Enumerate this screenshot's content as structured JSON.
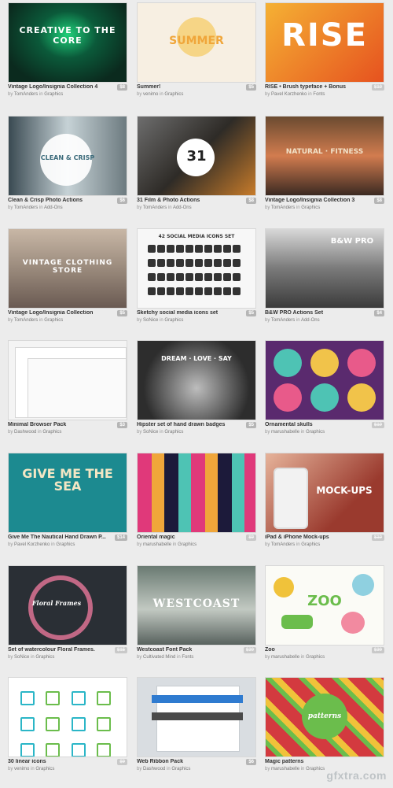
{
  "products": [
    {
      "title": "Vintage Logo/Insignia Collection 4",
      "by": "by",
      "author": "TomAnders",
      "in": "in",
      "category": "Graphics",
      "price": "$8",
      "sale": false,
      "thumb_text": "CREATIVE TO THE CORE",
      "thumb_colors": [
        "#0b2a1e",
        "#1fd07a"
      ]
    },
    {
      "title": "Summer!",
      "by": "by",
      "author": "venimo",
      "in": "in",
      "category": "Graphics",
      "price": "$5",
      "sale": false,
      "thumb_text": "SUMMER",
      "thumb_colors": [
        "#f7efe2",
        "#f0a63a"
      ]
    },
    {
      "title": "RISE • Brush typeface + Bonus",
      "by": "by",
      "author": "Pavel Korzhenko",
      "in": "in",
      "category": "Fonts",
      "price": "$10",
      "sale": true,
      "thumb_text": "RISE",
      "thumb_colors": [
        "#e6521f",
        "#f5b134"
      ]
    },
    {
      "title": "Clean & Crisp Photo Actions",
      "by": "by",
      "author": "TomAnders",
      "in": "in",
      "category": "Add-Ons",
      "price": "$6",
      "sale": false,
      "thumb_text": "CLEAN & CRISP",
      "thumb_colors": [
        "#3a4a52",
        "#c6d2d6"
      ]
    },
    {
      "title": "31 Film & Photo Actions",
      "by": "by",
      "author": "TomAnders",
      "in": "in",
      "category": "Add-Ons",
      "price": "$8",
      "sale": false,
      "thumb_text": "31",
      "thumb_colors": [
        "#2e2b27",
        "#c77b2a"
      ]
    },
    {
      "title": "Vintage Logo/Insignia Collection 3",
      "by": "by",
      "author": "TomAnders",
      "in": "in",
      "category": "Graphics",
      "price": "$8",
      "sale": false,
      "thumb_text": "NATURAL · FITNESS",
      "thumb_colors": [
        "#3b2a22",
        "#d27c4f"
      ]
    },
    {
      "title": "Vintage Logo/Insignia Collection",
      "by": "by",
      "author": "TomAnders",
      "in": "in",
      "category": "Graphics",
      "price": "$5",
      "sale": false,
      "thumb_text": "VINTAGE CLOTHING STORE",
      "thumb_colors": [
        "#6a5a52",
        "#c8b7a6"
      ]
    },
    {
      "title": "Sketchy social media icons set",
      "by": "by",
      "author": "SoNice",
      "in": "in",
      "category": "Graphics",
      "price": "$5",
      "sale": false,
      "thumb_text": "42 SOCIAL MEDIA ICONS SET",
      "thumb_colors": [
        "#f7f7f7",
        "#333333"
      ]
    },
    {
      "title": "B&W PRO Actions Set",
      "by": "by",
      "author": "TomAnders",
      "in": "in",
      "category": "Add-Ons",
      "price": "$4",
      "sale": false,
      "thumb_text": "B&W PRO",
      "thumb_colors": [
        "#3b3b3b",
        "#d8d8d8"
      ]
    },
    {
      "title": "Minimal Browser Pack",
      "by": "by",
      "author": "Dashwood",
      "in": "in",
      "category": "Graphics",
      "price": "$3",
      "sale": false,
      "thumb_text": "",
      "thumb_colors": [
        "#f4f4f4",
        "#d6d6d6"
      ]
    },
    {
      "title": "Hipster set of hand drawn badges",
      "by": "by",
      "author": "SoNice",
      "in": "in",
      "category": "Graphics",
      "price": "$5",
      "sale": false,
      "thumb_text": "DREAM · LOVE · SAY",
      "thumb_colors": [
        "#2d2d2d",
        "#bdbdbd"
      ]
    },
    {
      "title": "Ornamental skulls",
      "by": "by",
      "author": "marushabelle",
      "in": "in",
      "category": "Graphics",
      "price": "$10",
      "sale": true,
      "thumb_text": "",
      "thumb_colors": [
        "#5a2a6e",
        "#4ec3b4"
      ]
    },
    {
      "title": "Give Me The Nautical Hand Drawn P...",
      "by": "by",
      "author": "Pavel Korzhenko",
      "in": "in",
      "category": "Graphics",
      "price": "$14",
      "sale": false,
      "thumb_text": "GIVE ME THE SEA",
      "thumb_colors": [
        "#1c8a90",
        "#f3e6c4"
      ]
    },
    {
      "title": "Oriental magic",
      "by": "by",
      "author": "marushabelle",
      "in": "in",
      "category": "Graphics",
      "price": "$9",
      "sale": true,
      "thumb_text": "",
      "thumb_colors": [
        "#1c1a3a",
        "#e0397a"
      ]
    },
    {
      "title": "iPad & iPhone Mock-ups",
      "by": "by",
      "author": "TomAnders",
      "in": "in",
      "category": "Graphics",
      "price": "$10",
      "sale": true,
      "thumb_text": "MOCK-UPS",
      "thumb_colors": [
        "#9a3a2e",
        "#e6b39a"
      ]
    },
    {
      "title": "Set of watercolour Floral Frames.",
      "by": "by",
      "author": "SoNice",
      "in": "in",
      "category": "Graphics",
      "price": "$15",
      "sale": true,
      "thumb_text": "Floral Frames",
      "thumb_colors": [
        "#2a2f35",
        "#e7779a"
      ]
    },
    {
      "title": "Westcoast Font Pack",
      "by": "by",
      "author": "Cultivated Mind",
      "in": "in",
      "category": "Fonts",
      "price": "$30",
      "sale": true,
      "thumb_text": "WESTCOAST",
      "thumb_colors": [
        "#58625e",
        "#c2c9c2"
      ]
    },
    {
      "title": "Zoo",
      "by": "by",
      "author": "marushabelle",
      "in": "in",
      "category": "Graphics",
      "price": "$30",
      "sale": true,
      "thumb_text": "ZOO",
      "thumb_colors": [
        "#fbfbf6",
        "#f0c23a"
      ]
    },
    {
      "title": "30 linear icons",
      "by": "by",
      "author": "venimo",
      "in": "in",
      "category": "Graphics",
      "price": "$9",
      "sale": true,
      "thumb_text": "",
      "thumb_colors": [
        "#ffffff",
        "#2bb6c7"
      ]
    },
    {
      "title": "Web Ribbon Pack",
      "by": "by",
      "author": "Dashwood",
      "in": "in",
      "category": "Graphics",
      "price": "$6",
      "sale": false,
      "thumb_text": "",
      "thumb_colors": [
        "#d9dde1",
        "#2f7bd0"
      ]
    },
    {
      "title": "Magic patterns",
      "by": "by",
      "author": "marushabelle",
      "in": "in",
      "category": "Graphics",
      "price": "",
      "sale": false,
      "thumb_text": "patterns",
      "thumb_colors": [
        "#d33a3f",
        "#6bbd4c"
      ]
    }
  ],
  "watermark": "gfxtra.com"
}
